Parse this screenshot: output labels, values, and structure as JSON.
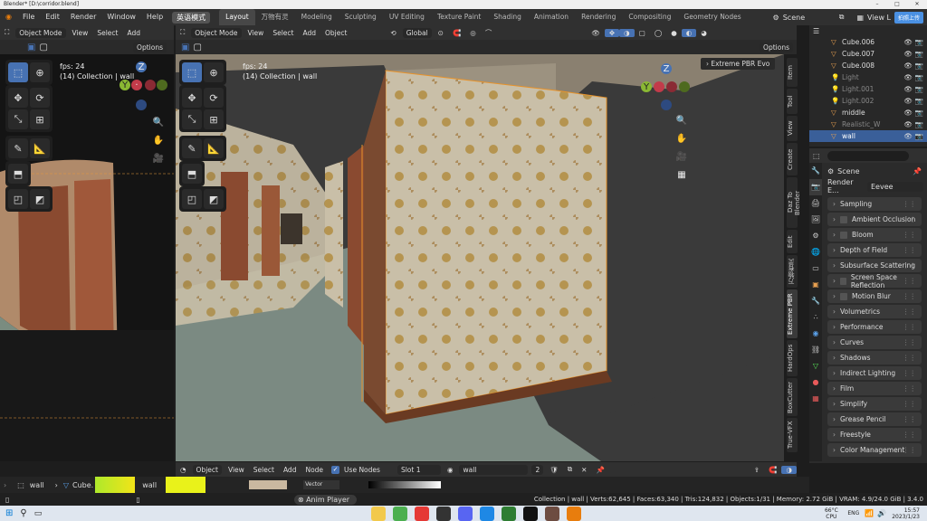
{
  "titlebar": {
    "title": "Blender* [D:\\corridor.blend]"
  },
  "menu": {
    "file": "File",
    "edit": "Edit",
    "render": "Render",
    "window": "Window",
    "help": "Help",
    "mode_btn": "英语模式"
  },
  "workspaces": [
    "Layout",
    "万物有灵",
    "Modeling",
    "Sculpting",
    "UV Editing",
    "Texture Paint",
    "Shading",
    "Animation",
    "Rendering",
    "Compositing",
    "Geometry Nodes"
  ],
  "scene": {
    "label": "Scene",
    "view_layer": "View L",
    "upload": "拍照上传"
  },
  "left_vp": {
    "mode": "Object Mode",
    "view": "View",
    "select": "Select",
    "add": "Add",
    "options": "Options",
    "fps": "fps: 24",
    "collection": "(14) Collection | wall"
  },
  "main_vp": {
    "mode": "Object Mode",
    "view": "View",
    "select": "Select",
    "add": "Add",
    "object": "Object",
    "transform": "Global",
    "options": "Options",
    "fps": "fps: 24",
    "collection": "(14) Collection | wall",
    "npanel_header": "Extreme PBR Evo"
  },
  "side_tabs": [
    "Item",
    "Tool",
    "View",
    "Create",
    "Daz To Blender",
    "Edit",
    "万物有灵",
    "Extreme PBR",
    "HardOps",
    "BoxCutter",
    "True-VFX"
  ],
  "outliner": {
    "rows": [
      {
        "name": "Cube.006",
        "dim": false
      },
      {
        "name": "Cube.007",
        "dim": false
      },
      {
        "name": "Cube.008",
        "dim": false
      },
      {
        "name": "Light",
        "dim": true
      },
      {
        "name": "Light.001",
        "dim": true
      },
      {
        "name": "Light.002",
        "dim": true
      },
      {
        "name": "middle",
        "dim": false
      },
      {
        "name": "Realistic_W",
        "dim": true
      },
      {
        "name": "wall",
        "dim": false
      }
    ]
  },
  "properties": {
    "scene": "Scene",
    "render_engine_label": "Render E...",
    "render_engine": "Eevee",
    "panels": [
      "Sampling",
      "Ambient Occlusion",
      "Bloom",
      "Depth of Field",
      "Subsurface Scattering",
      "Screen Space Reflection",
      "Motion Blur",
      "Volumetrics",
      "Performance",
      "Curves",
      "Shadows",
      "Indirect Lighting",
      "Film",
      "Simplify",
      "Grease Pencil",
      "Freestyle",
      "Color Management"
    ]
  },
  "node_header": {
    "object": "Object",
    "view": "View",
    "select": "Select",
    "add": "Add",
    "node": "Node",
    "use_nodes": "Use Nodes",
    "slot": "Slot 1",
    "material": "wall",
    "users": "2"
  },
  "bottom": {
    "wall": "wall",
    "cube": "Cube.",
    "wall2": "wall",
    "anim_player": "Anim Player",
    "vector": "Vector"
  },
  "statusbar": {
    "text": "Collection | wall | Verts:62,645 | Faces:63,340 | Tris:124,832 | Objects:1/31 | Memory: 2.72 GiB | VRAM: 4.9/24.0 GiB | 3.4.0"
  },
  "taskbar": {
    "weather": "66°C CPU",
    "lang": "ENG",
    "time": "15:57",
    "date": "2023/1/23"
  }
}
